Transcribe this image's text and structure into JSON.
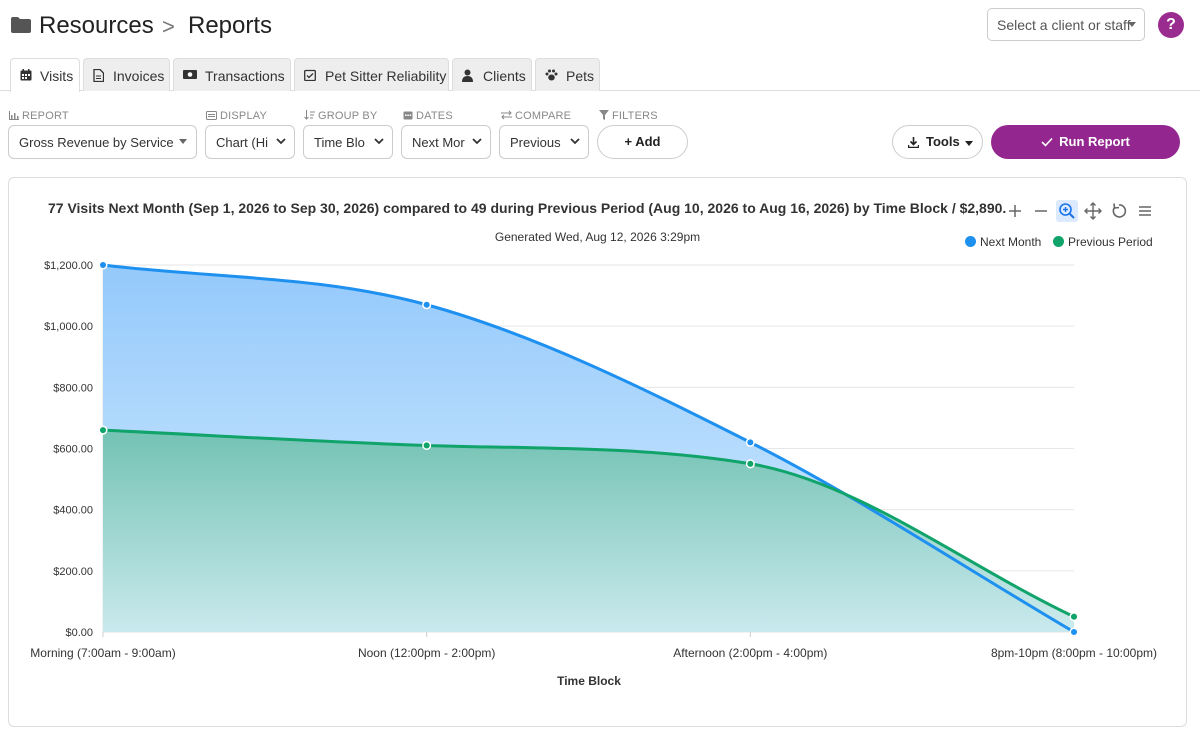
{
  "header": {
    "breadcrumb_root": "Resources",
    "breadcrumb_sep": ">",
    "breadcrumb_current": "Reports",
    "client_select_placeholder": "Select a client or staff",
    "help_label": "?"
  },
  "tabs": [
    {
      "label": "Visits",
      "icon": "calendar-icon",
      "active": true
    },
    {
      "label": "Invoices",
      "icon": "document-icon",
      "active": false
    },
    {
      "label": "Transactions",
      "icon": "money-icon",
      "active": false
    },
    {
      "label": "Pet Sitter Reliability",
      "icon": "checklist-icon",
      "active": false
    },
    {
      "label": "Clients",
      "icon": "person-icon",
      "active": false
    },
    {
      "label": "Pets",
      "icon": "paw-icon",
      "active": false
    }
  ],
  "controls": {
    "report": {
      "label": "REPORT",
      "value": "Gross Revenue by Service"
    },
    "display": {
      "label": "DISPLAY",
      "value": "Chart (Hi"
    },
    "group_by": {
      "label": "GROUP BY",
      "value": "Time Blo"
    },
    "dates": {
      "label": "DATES",
      "value": "Next Mor"
    },
    "compare": {
      "label": "COMPARE",
      "value": "Previous"
    },
    "filters": {
      "label": "FILTERS",
      "add_label": "+ Add"
    },
    "tools_label": "Tools",
    "run_label": "Run Report"
  },
  "colors": {
    "accent": "#93278f",
    "series_next_month": "#1e90f0",
    "series_previous": "#10a36a"
  },
  "chart_data": {
    "type": "area",
    "title": "77 Visits Next Month (Sep 1, 2026 to Sep 30, 2026) compared to 49 during Previous Period (Aug 10, 2026 to Aug 16, 2026) by Time Block / $2,890.",
    "subtitle": "Generated Wed, Aug 12, 2026 3:29pm",
    "xlabel": "Time Block",
    "ylabel": "",
    "categories": [
      "Morning (7:00am - 9:00am)",
      "Noon (12:00pm - 2:00pm)",
      "Afternoon (2:00pm - 4:00pm)",
      "8pm-10pm (8:00pm - 10:00pm)"
    ],
    "y_ticks": [
      "$0.00",
      "$200.00",
      "$400.00",
      "$600.00",
      "$800.00",
      "$1,000.00",
      "$1,200.00"
    ],
    "ylim": [
      0,
      1200
    ],
    "series": [
      {
        "name": "Next Month",
        "values": [
          1200,
          1070,
          620,
          0
        ]
      },
      {
        "name": "Previous Period",
        "values": [
          660,
          610,
          550,
          50
        ]
      }
    ],
    "legend_position": "top-right",
    "grid": true
  }
}
